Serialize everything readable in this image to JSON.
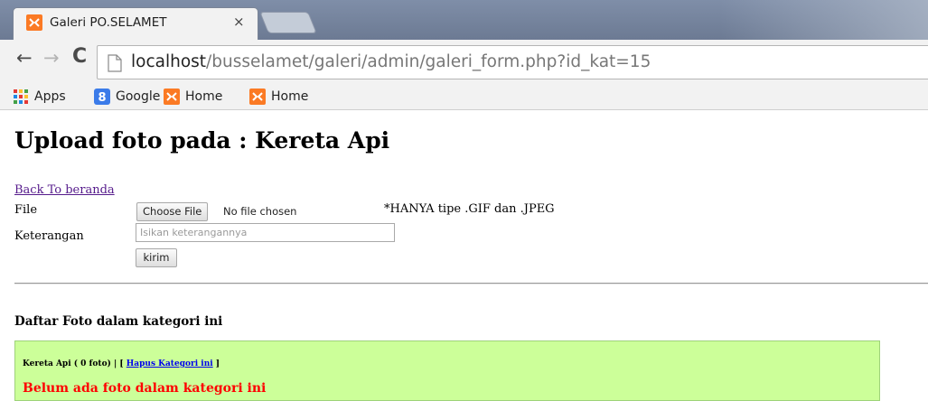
{
  "browser": {
    "tab": {
      "title": "Galeri PO.SELAMET",
      "close_glyph": "×",
      "favicon": "xampp-icon"
    },
    "url": {
      "host": "localhost",
      "path": "/busselamet/galeri/admin/galeri_form.php?id_kat=15"
    },
    "bookmarks": [
      {
        "label": "Apps",
        "icon": "apps-grid-icon"
      },
      {
        "label": "Google",
        "icon": "google-icon"
      },
      {
        "label": "Home",
        "icon": "xampp-icon"
      },
      {
        "label": "Home",
        "icon": "xampp-icon"
      }
    ]
  },
  "page": {
    "heading": "Upload foto pada : Kereta Api",
    "back_link": "Back To beranda",
    "form": {
      "file_label": "File",
      "choose_button": "Choose File",
      "no_file_text": "No file chosen",
      "hint": "*HANYA tipe .GIF dan .JPEG",
      "keterangan_label": "Keterangan",
      "keterangan_placeholder": "Isikan keterangannya",
      "submit_label": "kirim"
    },
    "list_title": "Daftar Foto dalam kategori ini",
    "category": {
      "prefix": "Kereta Api ( 0 foto) | [ ",
      "delete_link": "Hapus Kategori ini",
      "suffix": " ]",
      "empty_message": "Belum ada foto dalam kategori ini"
    }
  },
  "colors": {
    "category_box": "#ccff99",
    "empty_message": "#ff0000",
    "visited_link": "#551a8b"
  }
}
